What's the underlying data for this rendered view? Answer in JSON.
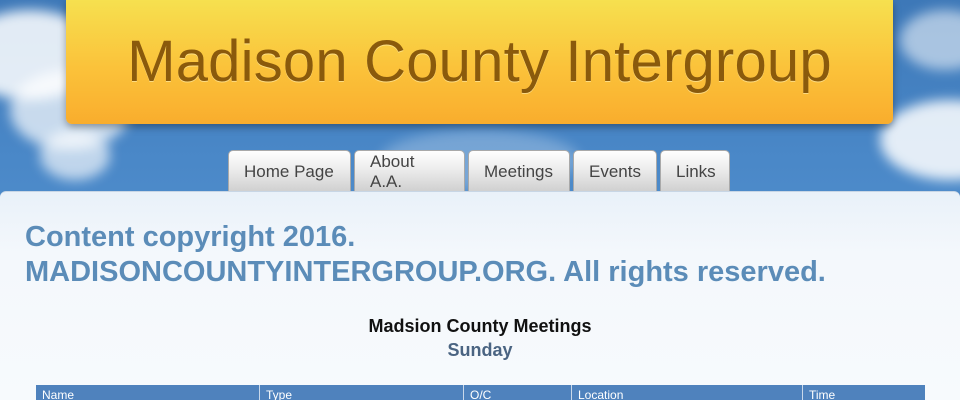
{
  "header": {
    "site_title": "Madison County Intergroup"
  },
  "nav": {
    "tabs": [
      {
        "label": "Home Page"
      },
      {
        "label": "About A.A."
      },
      {
        "label": "Meetings"
      },
      {
        "label": "Events"
      },
      {
        "label": "Links"
      }
    ]
  },
  "main": {
    "copyright_line1": "Content copyright 2016.",
    "copyright_line2": "MADISONCOUNTYINTERGROUP.ORG. All rights reserved.",
    "meetings_title": "Madsion County Meetings",
    "day": "Sunday",
    "table": {
      "columns": [
        "Name",
        "Type",
        "O/C",
        "Location",
        "Time"
      ]
    }
  },
  "colors": {
    "banner_gold": "#fbc23a",
    "title_brown": "#8a5a0c",
    "copyright_blue": "#5b8cb8",
    "table_header_blue": "#4f82bd"
  }
}
